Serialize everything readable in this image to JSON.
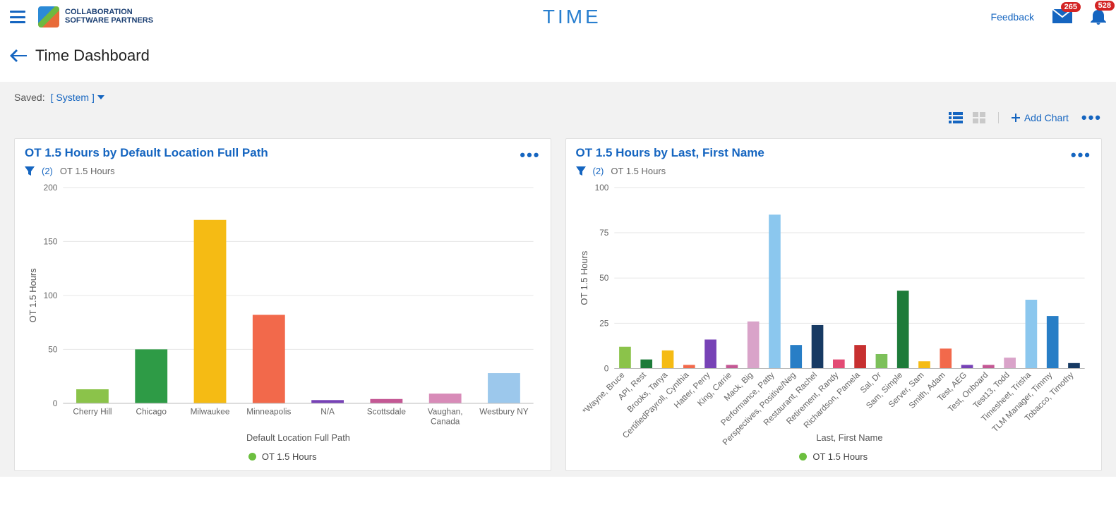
{
  "header": {
    "app_title": "TIME",
    "logo_line1": "COLLABORATION",
    "logo_line2": "SOFTWARE PARTNERS",
    "feedback": "Feedback",
    "mail_badge": "265",
    "bell_badge": "528"
  },
  "page": {
    "title": "Time Dashboard"
  },
  "toolbar": {
    "saved_label": "Saved:",
    "saved_value": "[ System ]",
    "add_chart": "Add Chart"
  },
  "cards": {
    "left": {
      "title": "OT 1.5 Hours by Default Location Full Path",
      "filter_count": "(2)",
      "filter_label": "OT 1.5 Hours",
      "legend": "OT 1.5 Hours",
      "ylabel": "OT 1.5 Hours",
      "xlabel": "Default Location Full Path"
    },
    "right": {
      "title": "OT 1.5 Hours by Last, First Name",
      "filter_count": "(2)",
      "filter_label": "OT 1.5 Hours",
      "legend": "OT 1.5 Hours",
      "ylabel": "OT 1.5 Hours",
      "xlabel": "Last, First Name"
    }
  },
  "chart_data": [
    {
      "type": "bar",
      "title": "OT 1.5 Hours by Default Location Full Path",
      "xlabel": "Default Location Full Path",
      "ylabel": "OT 1.5 Hours",
      "ylim": [
        0,
        200
      ],
      "yticks": [
        0,
        50,
        100,
        150,
        200
      ],
      "categories": [
        "Cherry Hill",
        "Chicago",
        "Milwaukee",
        "Minneapolis",
        "N/A",
        "Scottsdale",
        "Vaughan, Canada",
        "Westbury NY"
      ],
      "values": [
        13,
        50,
        170,
        82,
        3,
        4,
        9,
        28
      ],
      "colors": [
        "#8bc34a",
        "#2e9b46",
        "#f5bb14",
        "#f2694b",
        "#7742b6",
        "#c45894",
        "#d88bb8",
        "#9cc8ec"
      ],
      "legend": [
        "OT 1.5 Hours"
      ]
    },
    {
      "type": "bar",
      "title": "OT 1.5 Hours by Last, First Name",
      "xlabel": "Last, First Name",
      "ylabel": "OT 1.5 Hours",
      "ylim": [
        0,
        100
      ],
      "yticks": [
        0,
        25,
        50,
        75,
        100
      ],
      "categories": [
        "*Wayne, Bruce",
        "API, Rest",
        "Brooks, Tanya",
        "CertifiedPayroll, Cynthia",
        "Hatter, Perry",
        "King, Carrie",
        "Mack, Big",
        "Performance, Patty",
        "Perspectives, Positive/Neg",
        "Restaurant, Rachel",
        "Retirement, Randy",
        "Richardson, Pamela",
        "Sal, Dr",
        "Sam, Simple",
        "Server, Sam",
        "Smith, Adam",
        "Test, AEG",
        "Test, Onboard",
        "Test13, Todd",
        "Timesheet, Trisha",
        "TLM Manager, Timmy",
        "Tobacco, Timothy"
      ],
      "values": [
        12,
        5,
        10,
        2,
        16,
        2,
        26,
        85,
        13,
        24,
        5,
        13,
        8,
        43,
        4,
        11,
        2,
        2,
        6,
        38,
        29,
        3
      ],
      "colors": [
        "#8bc34a",
        "#1d7b39",
        "#f5bb14",
        "#f2694b",
        "#7742b6",
        "#c45894",
        "#d9a3c9",
        "#8bc7ee",
        "#287ec6",
        "#173a63",
        "#e34b74",
        "#c73030",
        "#7cc05a",
        "#1d7b39",
        "#f5bb14",
        "#f2694b",
        "#7742b6",
        "#c45894",
        "#d9a3c9",
        "#8bc7ee",
        "#287ec6",
        "#173a63"
      ],
      "legend": [
        "OT 1.5 Hours"
      ]
    }
  ]
}
